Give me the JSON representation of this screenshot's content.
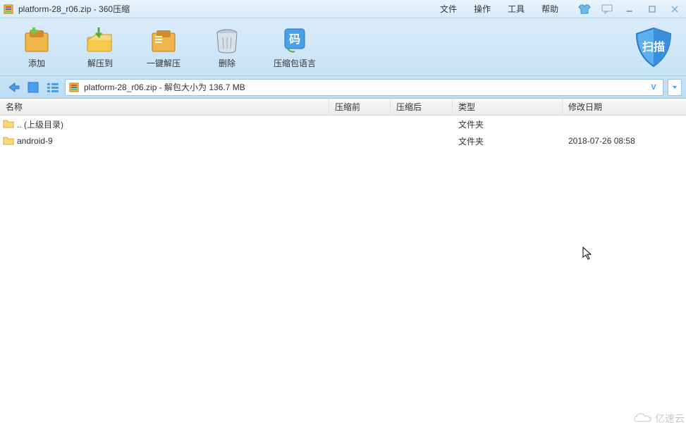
{
  "window": {
    "title": "platform-28_r06.zip - 360压缩"
  },
  "menus": {
    "file": "文件",
    "action": "操作",
    "tools": "工具",
    "help": "帮助"
  },
  "toolbar": {
    "add": "添加",
    "extract_to": "解压到",
    "one_click": "一键解压",
    "delete": "删除",
    "language": "压缩包语言",
    "scan": "扫 描"
  },
  "address": {
    "path": "platform-28_r06.zip - 解包大小为 136.7 MB"
  },
  "columns": {
    "name": "名称",
    "before": "压缩前",
    "after": "压缩后",
    "type": "类型",
    "date": "修改日期"
  },
  "rows": [
    {
      "name": ".. (上级目录)",
      "before": "",
      "after": "",
      "type": "文件夹",
      "date": ""
    },
    {
      "name": "android-9",
      "before": "",
      "after": "",
      "type": "文件夹",
      "date": "2018-07-26 08:58"
    }
  ],
  "watermark": "亿速云"
}
